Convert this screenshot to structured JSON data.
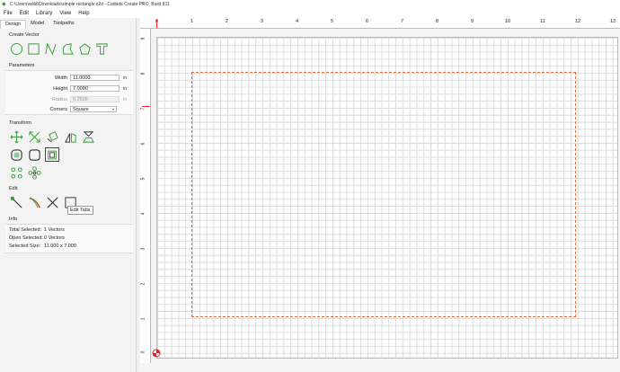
{
  "window": {
    "title": "C:\\Users\\willd\\Downloads\\simple rectangle.c2d - Carbide Create PRO, Build 811"
  },
  "menu": [
    "File",
    "Edit",
    "Library",
    "View",
    "Help"
  ],
  "tabs": [
    "Design",
    "Model",
    "Toolpaths"
  ],
  "sections": {
    "create_vector": "Create Vector",
    "parameters": "Parameters",
    "transform": "Transform",
    "edit": "Edit",
    "info": "Info"
  },
  "parameters": {
    "width": {
      "label": "Width",
      "value": "11.0000",
      "unit": "in"
    },
    "height": {
      "label": "Height",
      "value": "7.0000",
      "unit": "in"
    },
    "radius": {
      "label": "Radius",
      "value": "0.2500",
      "unit": "in"
    },
    "corners": {
      "label": "Corners",
      "value": "Square"
    }
  },
  "tooltip": "Edit Tabs",
  "info": {
    "total_selected": {
      "label": "Total Selected:",
      "value": "1 Vectors"
    },
    "open_selected": {
      "label": "Open Selected:",
      "value": "0 Vectors"
    },
    "selected_size": {
      "label": "Selected Size:",
      "value": "11.000 x 7.000"
    }
  },
  "ruler": {
    "x_ticks": [
      "0",
      "1",
      "2",
      "3",
      "4",
      "5",
      "6",
      "7",
      "8",
      "9",
      "10",
      "11",
      "12",
      "13"
    ],
    "y_ticks": [
      "9",
      "8",
      "7",
      "6",
      "5",
      "4",
      "3",
      "2",
      "1",
      "0"
    ]
  },
  "colors": {
    "accent": "#3a9a3a",
    "shape_outline": "#e0703a",
    "origin": "#e02020"
  }
}
